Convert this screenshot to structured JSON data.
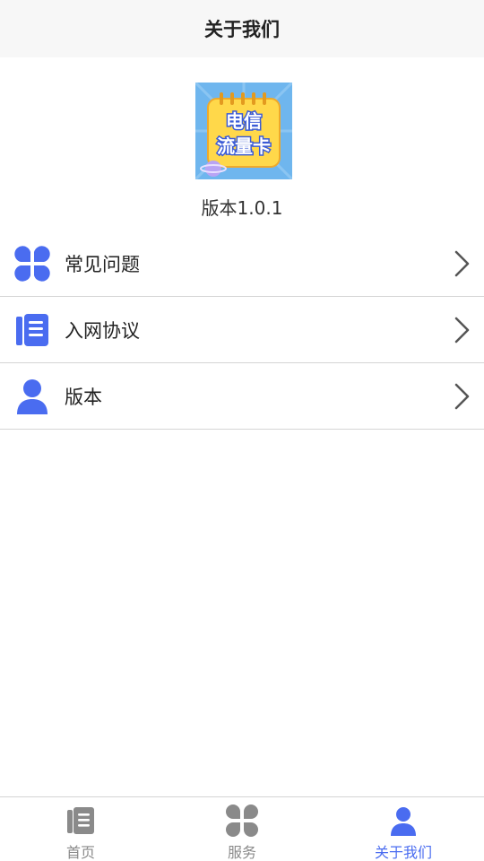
{
  "header": {
    "title": "关于我们"
  },
  "logo": {
    "line1": "电信",
    "line2": "流量卡",
    "colors": {
      "background": "#6fb6ee",
      "card": "#ffd84a",
      "text": "#ffffff",
      "text_outline": "#3b5bd6"
    }
  },
  "version_caption": "版本1.0.1",
  "menu": {
    "items": [
      {
        "label": "常见问题",
        "icon": "grid-icon"
      },
      {
        "label": "入网协议",
        "icon": "document-icon"
      },
      {
        "label": "版本",
        "icon": "user-icon"
      }
    ]
  },
  "tabbar": {
    "items": [
      {
        "label": "首页",
        "icon": "document-icon",
        "active": false
      },
      {
        "label": "服务",
        "icon": "grid-icon",
        "active": false
      },
      {
        "label": "关于我们",
        "icon": "user-icon",
        "active": true
      }
    ]
  },
  "colors": {
    "accent": "#4a6cf0",
    "inactive": "#8a8a8a",
    "text": "#222222",
    "divider": "#d5d5d5",
    "header_bg": "#f7f7f7"
  }
}
